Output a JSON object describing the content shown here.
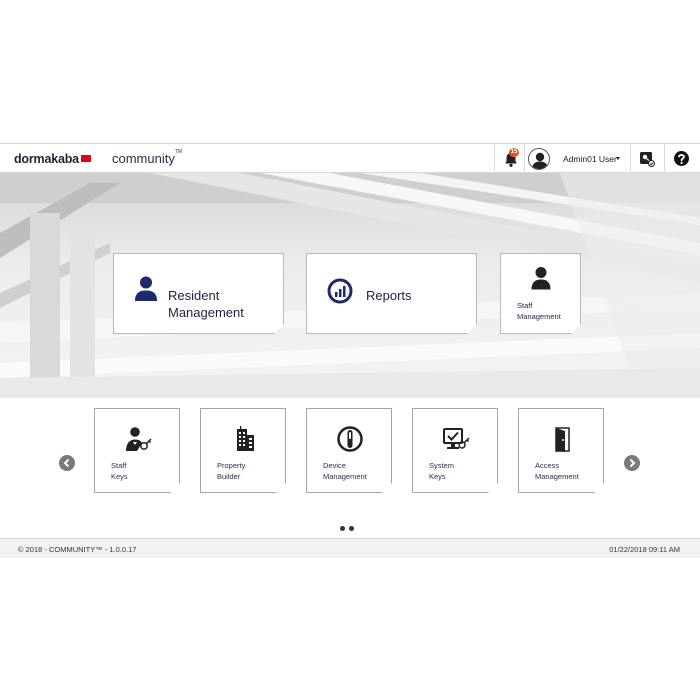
{
  "header": {
    "brand": "dormakaba",
    "product": "community",
    "product_mark": "TM",
    "notification_count": "15",
    "username": "Admin01 User",
    "icons": [
      "bell-icon",
      "user-avatar-icon",
      "key-fob-icon",
      "help-icon"
    ]
  },
  "hero_tiles": [
    {
      "id": "resident",
      "line1": "Resident",
      "line2": "Management",
      "icon": "resident-user-icon"
    },
    {
      "id": "reports",
      "label": "Reports",
      "icon": "reports-chart-icon"
    },
    {
      "id": "staff",
      "line1": "Staff",
      "line2": "Management",
      "icon": "staff-user-icon"
    }
  ],
  "carousel": {
    "tiles": [
      {
        "line1": "Staff",
        "line2": "Keys",
        "icon": "staff-keys-icon"
      },
      {
        "line1": "Property",
        "line2": "Builder",
        "icon": "building-icon"
      },
      {
        "line1": "Device",
        "line2": "Management",
        "icon": "device-lock-icon"
      },
      {
        "line1": "System",
        "line2": "Keys",
        "icon": "system-keys-icon"
      },
      {
        "line1": "Access",
        "line2": "Management",
        "icon": "door-icon"
      }
    ],
    "page_count": 2
  },
  "footer": {
    "copyright": "© 2018 - COMMUNITY™ - 1.0.0.17",
    "datetime": "01/22/2018 09:11 AM"
  },
  "colors": {
    "brand_red": "#e2001a",
    "accent_navy": "#1c2a6b",
    "badge_orange": "#e8541a"
  }
}
